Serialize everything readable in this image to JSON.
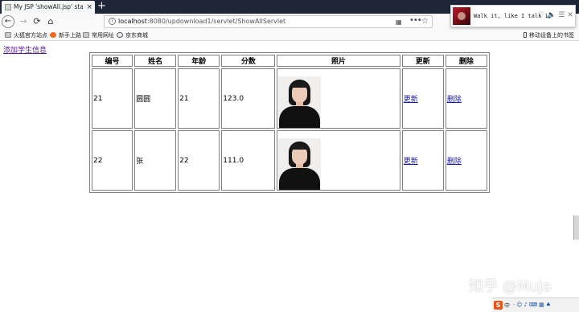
{
  "browser": {
    "tab_title": "My JSP 'showAll.jsp' starting page",
    "tab_close": "×",
    "new_tab": "+",
    "nav": {
      "back": "←",
      "forward": "→",
      "reload": "⟳",
      "home": "⌂"
    },
    "url_info": "i",
    "url_host": "localhost",
    "url_path": ":8080/updownload1/servlet/ShowAllServlet",
    "url_qr": "▦",
    "url_more": "•••",
    "url_star": "☆",
    "bookmarks": [
      {
        "label": "火狐官方站点",
        "icon": "folder-icon"
      },
      {
        "label": "新手上路",
        "icon": "firefox-icon"
      },
      {
        "label": "常用网址",
        "icon": "folder-icon"
      },
      {
        "label": "京东商城",
        "icon": "globe-icon"
      }
    ],
    "mobile_bookmarks": "移动设备上的书签"
  },
  "media": {
    "title": "Walk it, like I talk it",
    "icons": "♡🔈☰✕"
  },
  "page": {
    "add_link": "添加学生信息",
    "columns": [
      "编号",
      "姓名",
      "年龄",
      "分数",
      "照片",
      "更新",
      "删除"
    ],
    "rows": [
      {
        "id": "21",
        "name": "圆圆",
        "age": "21",
        "score": "123.0",
        "update": "更新",
        "delete": "删除"
      },
      {
        "id": "22",
        "name": "张",
        "age": "22",
        "score": "111.0",
        "update": "更新",
        "delete": "删除"
      }
    ]
  },
  "watermark": "知乎 @Muja",
  "taskbar": {
    "ime": "S",
    "ime_mode": "中",
    "tray": "·☺♪⌨▦♠"
  },
  "colors": {
    "chrome_dark": "#1f2638",
    "visited_link": "#551a8b",
    "link": "#1a1aa6",
    "table_border": "#808080"
  }
}
